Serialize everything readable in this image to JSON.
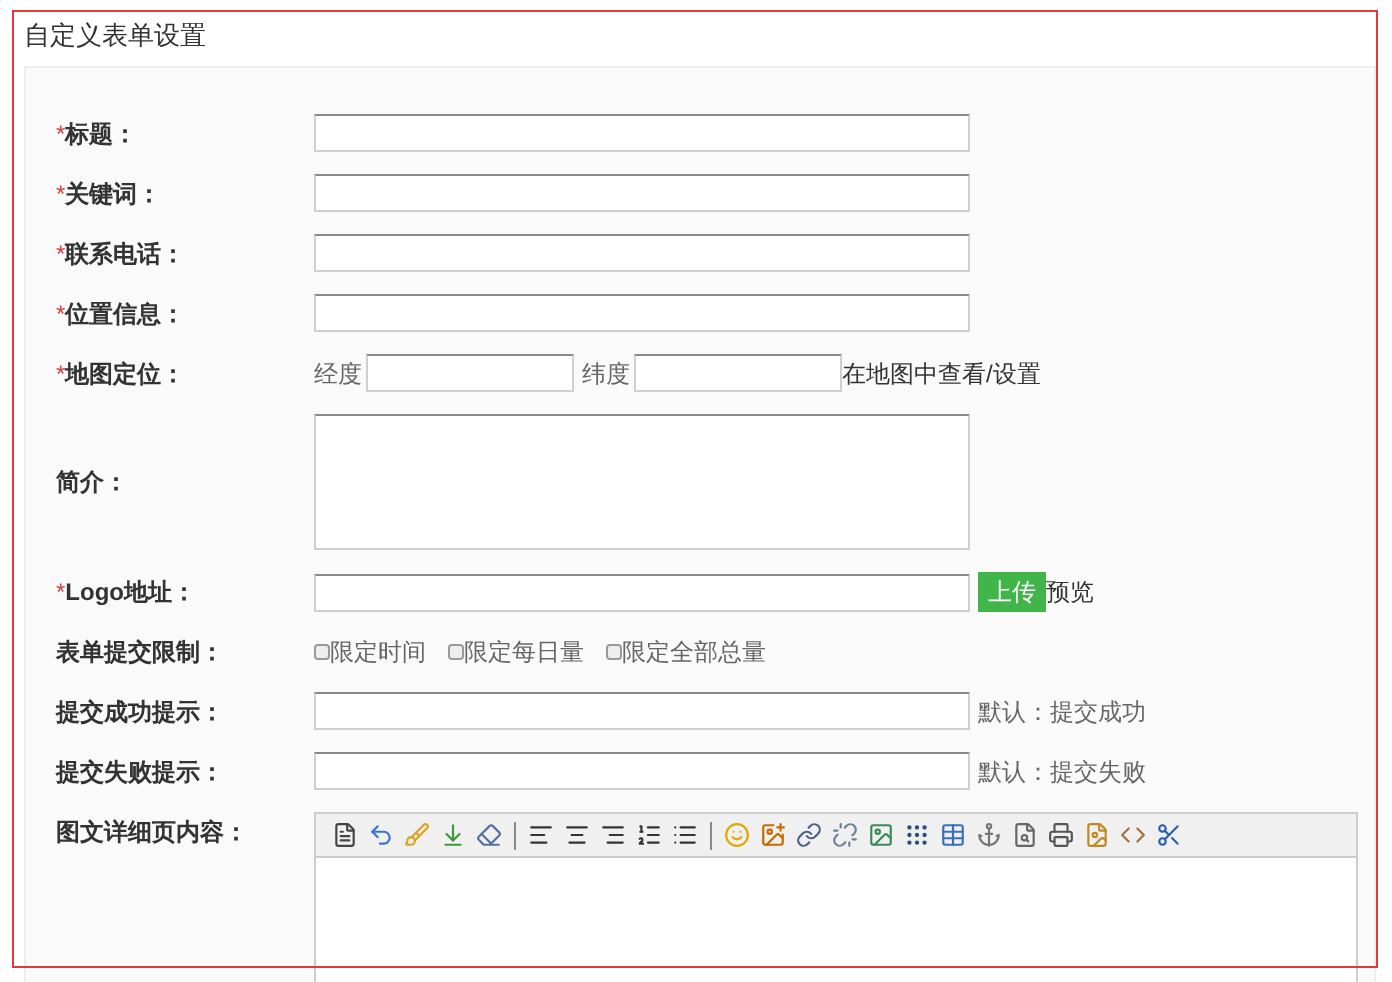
{
  "panel": {
    "title": "自定义表单设置"
  },
  "fields": [
    {
      "kind": "text",
      "marker": "*",
      "label": "标题："
    },
    {
      "kind": "text",
      "marker": "*",
      "label": "关键词："
    },
    {
      "kind": "text",
      "marker": "*",
      "label": "联系电话："
    },
    {
      "kind": "text",
      "marker": "*",
      "label": "位置信息："
    },
    {
      "kind": "coords",
      "marker": "*",
      "label": "地图定位：",
      "longitude_label": "经度",
      "latitude_label": "纬度",
      "link": "在地图中查看/设置"
    },
    {
      "kind": "textarea",
      "label": "简介："
    },
    {
      "kind": "upload",
      "marker": "*",
      "label": "Logo地址：",
      "button": "上传",
      "link": "预览"
    },
    {
      "kind": "checkboxes",
      "label": "表单提交限制：",
      "options": [
        {
          "label": "限定时间",
          "checked": false
        },
        {
          "label": "限定每日量",
          "checked": false
        },
        {
          "label": "限定全部总量",
          "checked": false
        }
      ]
    },
    {
      "kind": "text",
      "label": "提交成功提示：",
      "hint": "默认：提交成功"
    },
    {
      "kind": "text",
      "label": "提交失败提示：",
      "hint": "默认：提交失败"
    },
    {
      "kind": "editor",
      "label": "图文详细页内容："
    }
  ]
}
